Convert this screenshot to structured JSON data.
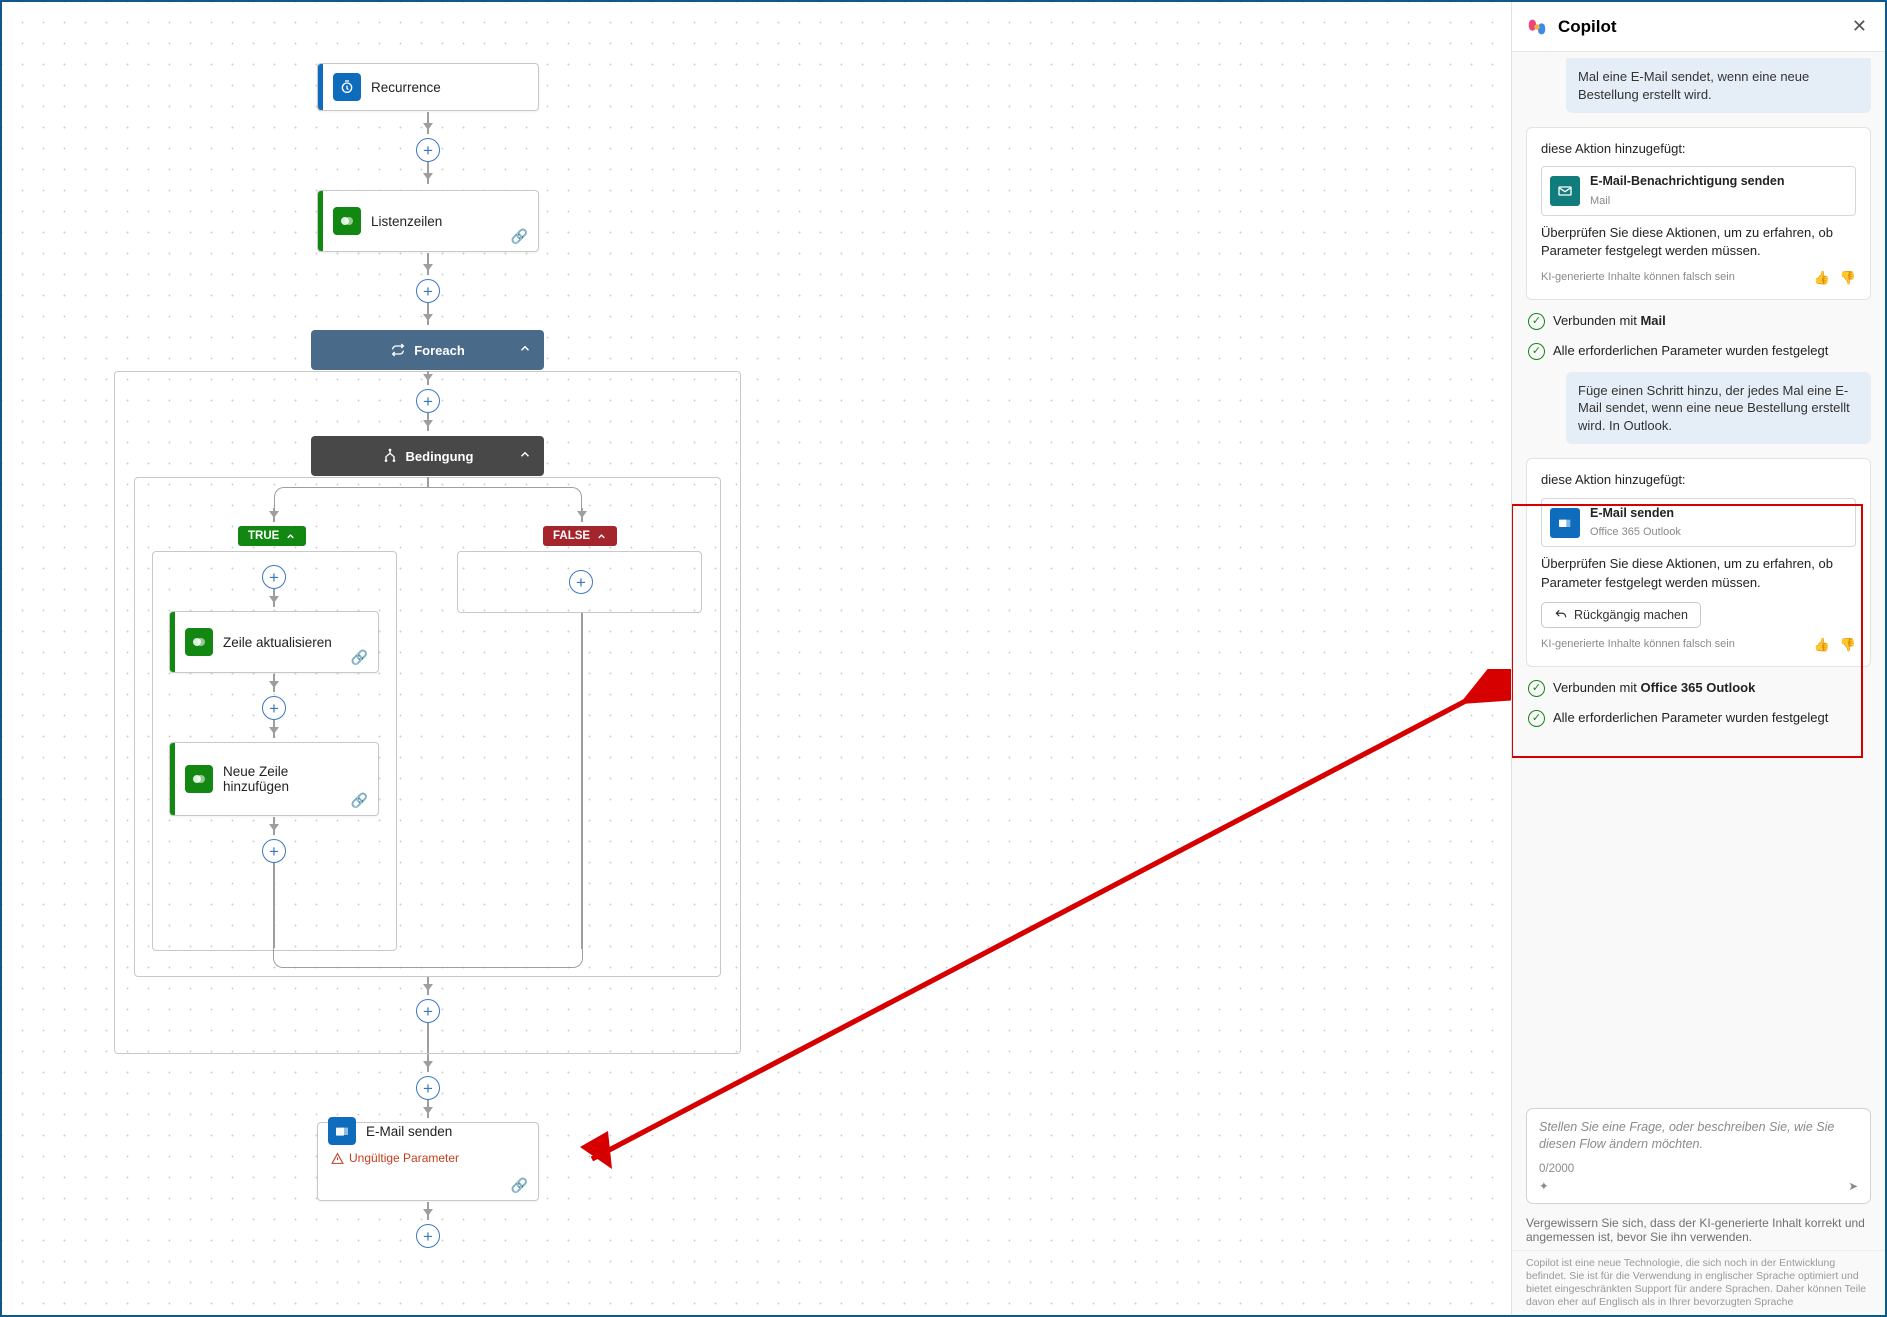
{
  "flow": {
    "recurrence": {
      "label": "Recurrence",
      "accent": "#0f6cbd",
      "iconBg": "#0f6cbd"
    },
    "listRows": {
      "label": "Listenzeilen",
      "accent": "#128712",
      "iconBg": "#128712"
    },
    "foreach": {
      "label": "Foreach",
      "bg": "#4a6a8a"
    },
    "condition": {
      "label": "Bedingung",
      "bg": "#484848"
    },
    "branchTrue": {
      "label": "TRUE",
      "bg": "#128712"
    },
    "branchFalse": {
      "label": "FALSE",
      "bg": "#a4262c"
    },
    "updateRow": {
      "label": "Zeile aktualisieren",
      "accent": "#128712",
      "iconBg": "#128712"
    },
    "addRow": {
      "label": "Neue Zeile hinzufügen",
      "accent": "#128712",
      "iconBg": "#128712"
    },
    "sendMail": {
      "label": "E-Mail senden",
      "sublabel": "Ungültige Parameter",
      "accent": "#0f6cbd",
      "iconBg": "#0f6cbd"
    }
  },
  "copilot": {
    "title": "Copilot",
    "userMsg1Frag": "Mal eine E-Mail sendet, wenn eine neue Bestellung erstellt wird.",
    "block1": {
      "header": "diese Aktion hinzugefügt:",
      "action": {
        "title": "E-Mail-Benachrichtigung senden",
        "subtitle": "Mail",
        "iconBg": "#107c7c"
      },
      "body": "Überprüfen Sie diese Aktionen, um zu erfahren, ob Parameter festgelegt werden müssen.",
      "disclaimer": "KI-generierte Inhalte können falsch sein"
    },
    "status1a": "Verbunden mit ",
    "status1aBold": "Mail",
    "status1b": "Alle erforderlichen Parameter wurden festgelegt",
    "userMsg2": "Füge einen Schritt hinzu, der jedes Mal eine E-Mail sendet, wenn eine neue Bestellung erstellt wird. In Outlook.",
    "block2": {
      "header": "diese Aktion hinzugefügt:",
      "action": {
        "title": "E-Mail senden",
        "subtitle": "Office 365 Outlook",
        "iconBg": "#0f6cbd"
      },
      "body": "Überprüfen Sie diese Aktionen, um zu erfahren, ob Parameter festgelegt werden müssen.",
      "undo": "Rückgängig machen",
      "disclaimer": "KI-generierte Inhalte können falsch sein"
    },
    "status2a": "Verbunden mit ",
    "status2aBold": "Office 365 Outlook",
    "status2b": "Alle erforderlichen Parameter wurden festgelegt",
    "input": {
      "placeholder": "Stellen Sie eine Frage, oder beschreiben Sie, wie Sie diesen Flow ändern möchten.",
      "counter": "0/2000"
    },
    "footer1": "Vergewissern Sie sich, dass der KI-generierte Inhalt korrekt und angemessen ist, bevor Sie ihn verwenden.",
    "footer2": "Copilot ist eine neue Technologie, die sich noch in der Entwicklung befindet. Sie ist für die Verwendung in englischer Sprache optimiert und bietet eingeschränkten Support für andere Sprachen. Daher können Teile davon eher auf Englisch als in Ihrer bevorzugten Sprache"
  }
}
